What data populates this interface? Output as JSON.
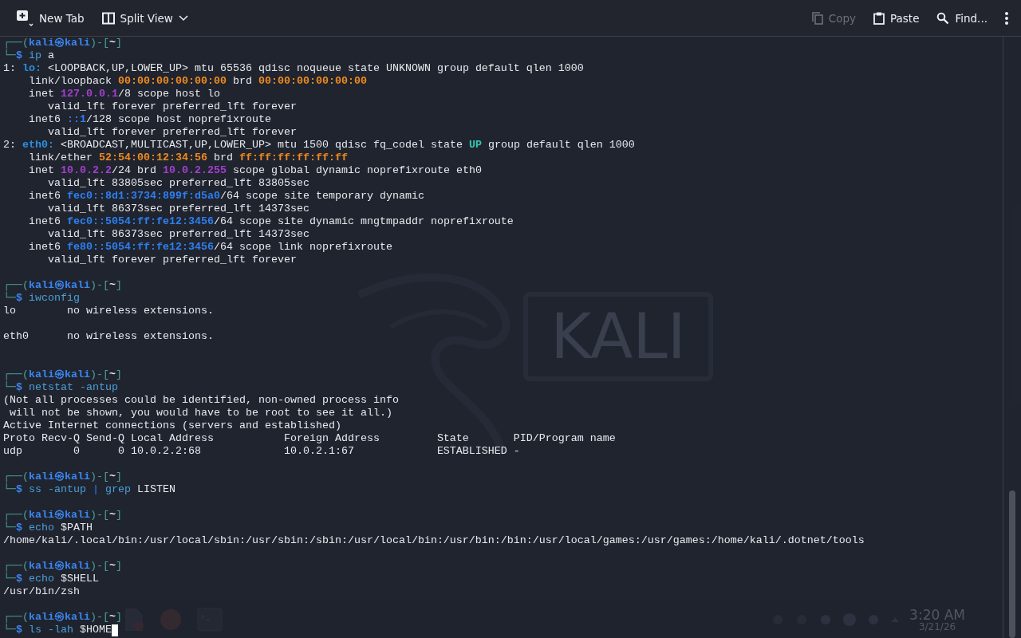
{
  "toolbar": {
    "left": [
      {
        "kind": "new-tab",
        "label": "New Tab",
        "disabled": false
      },
      {
        "kind": "split",
        "label": "Split View",
        "disabled": false
      }
    ],
    "right": [
      {
        "kind": "copy",
        "label": "Copy",
        "disabled": true
      },
      {
        "kind": "paste",
        "label": "Paste",
        "disabled": false
      },
      {
        "kind": "find",
        "label": "Find...",
        "disabled": false
      }
    ]
  },
  "desktop": {
    "logo": "KALI",
    "clock": {
      "time": "3:20 AM",
      "date": "3/21/26"
    }
  },
  "terminal": {
    "lines": [
      {
        "kind": "prompt",
        "open": "┌──(",
        "user": "kali㉿kali",
        "mid": ")-[",
        "dir": "~",
        "close": "]"
      },
      {
        "kind": "command",
        "corner": "└─",
        "sigil": "$",
        "segments": [
          {
            "kind": "cmd",
            "text": " ip"
          },
          {
            "kind": "arg",
            "text": " a"
          }
        ]
      },
      {
        "kind": "output",
        "segments": [
          {
            "kind": "plain",
            "text": "1: "
          },
          {
            "kind": "iface",
            "text": "lo:"
          },
          {
            "kind": "plain",
            "text": " <LOOPBACK,UP,LOWER_UP> mtu 65536 qdisc noqueue state UNKNOWN group default qlen 1000"
          }
        ]
      },
      {
        "kind": "output",
        "segments": [
          {
            "kind": "plain",
            "text": "    link/loopback "
          },
          {
            "kind": "mac",
            "text": "00:00:00:00:00:00"
          },
          {
            "kind": "plain",
            "text": " brd "
          },
          {
            "kind": "mac",
            "text": "00:00:00:00:00:00"
          }
        ]
      },
      {
        "kind": "output",
        "segments": [
          {
            "kind": "plain",
            "text": "    inet "
          },
          {
            "kind": "ip4",
            "text": "127.0.0.1"
          },
          {
            "kind": "plain",
            "text": "/8 scope host lo"
          }
        ]
      },
      {
        "kind": "output",
        "segments": [
          {
            "kind": "plain",
            "text": "       valid_lft forever preferred_lft forever"
          }
        ]
      },
      {
        "kind": "output",
        "segments": [
          {
            "kind": "plain",
            "text": "    inet6 "
          },
          {
            "kind": "ip6",
            "text": "::1"
          },
          {
            "kind": "plain",
            "text": "/128 scope host noprefixroute"
          }
        ]
      },
      {
        "kind": "output",
        "segments": [
          {
            "kind": "plain",
            "text": "       valid_lft forever preferred_lft forever"
          }
        ]
      },
      {
        "kind": "output",
        "segments": [
          {
            "kind": "plain",
            "text": "2: "
          },
          {
            "kind": "iface",
            "text": "eth0:"
          },
          {
            "kind": "plain",
            "text": " <BROADCAST,MULTICAST,UP,LOWER_UP> mtu 1500 qdisc fq_codel state "
          },
          {
            "kind": "up",
            "text": "UP"
          },
          {
            "kind": "plain",
            "text": " group default qlen 1000"
          }
        ]
      },
      {
        "kind": "output",
        "segments": [
          {
            "kind": "plain",
            "text": "    link/ether "
          },
          {
            "kind": "mac",
            "text": "52:54:00:12:34:56"
          },
          {
            "kind": "plain",
            "text": " brd "
          },
          {
            "kind": "mac",
            "text": "ff:ff:ff:ff:ff:ff"
          }
        ]
      },
      {
        "kind": "output",
        "segments": [
          {
            "kind": "plain",
            "text": "    inet "
          },
          {
            "kind": "ip4",
            "text": "10.0.2.2"
          },
          {
            "kind": "plain",
            "text": "/24 brd "
          },
          {
            "kind": "ip4",
            "text": "10.0.2.255"
          },
          {
            "kind": "plain",
            "text": " scope global dynamic noprefixroute eth0"
          }
        ]
      },
      {
        "kind": "output",
        "segments": [
          {
            "kind": "plain",
            "text": "       valid_lft 83805sec preferred_lft 83805sec"
          }
        ]
      },
      {
        "kind": "output",
        "segments": [
          {
            "kind": "plain",
            "text": "    inet6 "
          },
          {
            "kind": "ip6",
            "text": "fec0::8d1:3734:899f:d5a0"
          },
          {
            "kind": "plain",
            "text": "/64 scope site temporary dynamic"
          }
        ]
      },
      {
        "kind": "output",
        "segments": [
          {
            "kind": "plain",
            "text": "       valid_lft 86373sec preferred_lft 14373sec"
          }
        ]
      },
      {
        "kind": "output",
        "segments": [
          {
            "kind": "plain",
            "text": "    inet6 "
          },
          {
            "kind": "ip6",
            "text": "fec0::5054:ff:fe12:3456"
          },
          {
            "kind": "plain",
            "text": "/64 scope site dynamic mngtmpaddr noprefixroute"
          }
        ]
      },
      {
        "kind": "output",
        "segments": [
          {
            "kind": "plain",
            "text": "       valid_lft 86373sec preferred_lft 14373sec"
          }
        ]
      },
      {
        "kind": "output",
        "segments": [
          {
            "kind": "plain",
            "text": "    inet6 "
          },
          {
            "kind": "ip6",
            "text": "fe80::5054:ff:fe12:3456"
          },
          {
            "kind": "plain",
            "text": "/64 scope link noprefixroute"
          }
        ]
      },
      {
        "kind": "output",
        "segments": [
          {
            "kind": "plain",
            "text": "       valid_lft forever preferred_lft forever"
          }
        ]
      },
      {
        "kind": "blank"
      },
      {
        "kind": "prompt",
        "open": "┌──(",
        "user": "kali㉿kali",
        "mid": ")-[",
        "dir": "~",
        "close": "]"
      },
      {
        "kind": "command",
        "corner": "└─",
        "sigil": "$",
        "segments": [
          {
            "kind": "cmd",
            "text": " iwconfig"
          }
        ]
      },
      {
        "kind": "output",
        "segments": [
          {
            "kind": "plain",
            "text": "lo        no wireless extensions."
          }
        ]
      },
      {
        "kind": "blank"
      },
      {
        "kind": "output",
        "segments": [
          {
            "kind": "plain",
            "text": "eth0      no wireless extensions."
          }
        ]
      },
      {
        "kind": "blank"
      },
      {
        "kind": "blank"
      },
      {
        "kind": "prompt",
        "open": "┌──(",
        "user": "kali㉿kali",
        "mid": ")-[",
        "dir": "~",
        "close": "]"
      },
      {
        "kind": "command",
        "corner": "└─",
        "sigil": "$",
        "segments": [
          {
            "kind": "cmd",
            "text": " netstat -antup"
          }
        ]
      },
      {
        "kind": "output",
        "segments": [
          {
            "kind": "plain",
            "text": "(Not all processes could be identified, non-owned process info"
          }
        ]
      },
      {
        "kind": "output",
        "segments": [
          {
            "kind": "plain",
            "text": " will not be shown, you would have to be root to see it all.)"
          }
        ]
      },
      {
        "kind": "output",
        "segments": [
          {
            "kind": "plain",
            "text": "Active Internet connections (servers and established)"
          }
        ]
      },
      {
        "kind": "output",
        "segments": [
          {
            "kind": "plain",
            "text": "Proto Recv-Q Send-Q Local Address           Foreign Address         State       PID/Program name"
          }
        ]
      },
      {
        "kind": "output",
        "segments": [
          {
            "kind": "plain",
            "text": "udp        0      0 10.0.2.2:68             10.0.2.1:67             ESTABLISHED -"
          }
        ]
      },
      {
        "kind": "blank"
      },
      {
        "kind": "prompt",
        "open": "┌──(",
        "user": "kali㉿kali",
        "mid": ")-[",
        "dir": "~",
        "close": "]"
      },
      {
        "kind": "command",
        "corner": "└─",
        "sigil": "$",
        "segments": [
          {
            "kind": "cmd",
            "text": " ss -antup "
          },
          {
            "kind": "pipe",
            "text": "|"
          },
          {
            "kind": "cmd",
            "text": " grep"
          },
          {
            "kind": "arg",
            "text": " LISTEN"
          }
        ]
      },
      {
        "kind": "blank"
      },
      {
        "kind": "prompt",
        "open": "┌──(",
        "user": "kali㉿kali",
        "mid": ")-[",
        "dir": "~",
        "close": "]"
      },
      {
        "kind": "command",
        "corner": "└─",
        "sigil": "$",
        "segments": [
          {
            "kind": "cmd",
            "text": " echo"
          },
          {
            "kind": "arg",
            "text": " $PATH"
          }
        ]
      },
      {
        "kind": "output",
        "segments": [
          {
            "kind": "plain",
            "text": "/home/kali/.local/bin:/usr/local/sbin:/usr/sbin:/sbin:/usr/local/bin:/usr/bin:/bin:/usr/local/games:/usr/games:/home/kali/.dotnet/tools"
          }
        ]
      },
      {
        "kind": "blank"
      },
      {
        "kind": "prompt",
        "open": "┌──(",
        "user": "kali㉿kali",
        "mid": ")-[",
        "dir": "~",
        "close": "]"
      },
      {
        "kind": "command",
        "corner": "└─",
        "sigil": "$",
        "segments": [
          {
            "kind": "cmd",
            "text": " echo"
          },
          {
            "kind": "arg",
            "text": " $SHELL"
          }
        ]
      },
      {
        "kind": "output",
        "segments": [
          {
            "kind": "plain",
            "text": "/usr/bin/zsh"
          }
        ]
      },
      {
        "kind": "blank"
      },
      {
        "kind": "prompt",
        "open": "┌──(",
        "user": "kali㉿kali",
        "mid": ")-[",
        "dir": "~",
        "close": "]"
      },
      {
        "kind": "command",
        "corner": "└─",
        "sigil": "$",
        "cursor": true,
        "segments": [
          {
            "kind": "cmd",
            "text": " ls -lah"
          },
          {
            "kind": "arg",
            "text": " $HOME"
          }
        ]
      }
    ]
  }
}
